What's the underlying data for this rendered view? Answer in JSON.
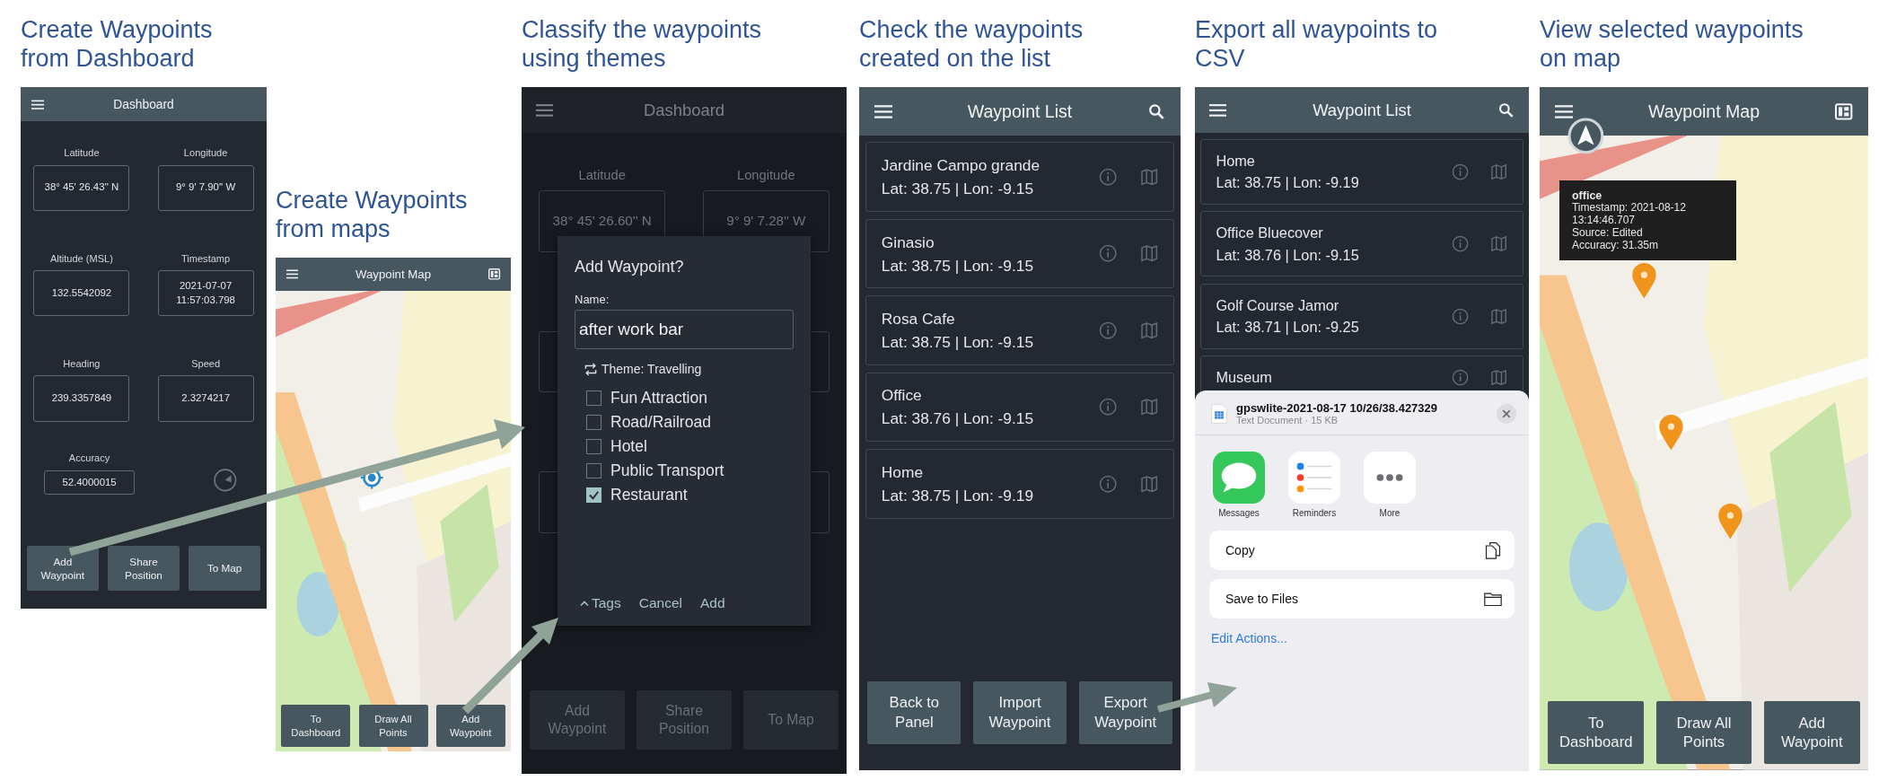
{
  "panels": [
    {
      "kind": "dashboard",
      "caption": "Create Waypoints from Dashboard",
      "screen": {
        "title": "Dashboard",
        "fields": [
          {
            "label": "Latitude",
            "value": "38° 45' 26.43'' N"
          },
          {
            "label": "Longitude",
            "value": "9° 9' 7.90'' W"
          },
          {
            "label": "Altitude (MSL)",
            "value": "132.5542092"
          },
          {
            "label": "Timestamp",
            "value": "2021-07-07 11:57:03.798"
          },
          {
            "label": "Heading",
            "value": "239.3357849"
          },
          {
            "label": "Speed",
            "value": "2.3274217"
          }
        ],
        "accuracy": {
          "label": "Accuracy",
          "value": "52.4000015"
        },
        "buttons": [
          "Add Waypoint",
          "Share Position",
          "To Map"
        ]
      }
    },
    {
      "kind": "map",
      "caption": "Create Waypoints from maps",
      "screen": {
        "title": "Waypoint Map",
        "buttons": [
          "To Dashboard",
          "Draw All Points",
          "Add Waypoint"
        ]
      }
    },
    {
      "kind": "dialog",
      "caption": "Classify the waypoints using themes",
      "screen": {
        "title": "Dashboard",
        "fields": [
          {
            "label": "Latitude",
            "value": "38° 45' 26.60'' N"
          },
          {
            "label": "Longitude",
            "value": "9° 9' 7.28'' W"
          }
        ],
        "buttons": [
          "Add Waypoint",
          "Share Position",
          "To Map"
        ],
        "dialog": {
          "title": "Add Waypoint?",
          "name_label": "Name:",
          "name_value": "after work bar",
          "theme": "Theme: Travelling",
          "options": [
            {
              "label": "Fun Attraction",
              "checked": false
            },
            {
              "label": "Road/Railroad",
              "checked": false
            },
            {
              "label": "Hotel",
              "checked": false
            },
            {
              "label": "Public Transport",
              "checked": false
            },
            {
              "label": "Restaurant",
              "checked": true
            }
          ],
          "actions": [
            "Tags",
            "Cancel",
            "Add"
          ]
        }
      }
    },
    {
      "kind": "list",
      "caption": "Check the waypoints created on the list",
      "screen": {
        "title": "Waypoint List",
        "items": [
          {
            "name": "Jardine Campo grande",
            "coords": "Lat: 38.75 | Lon: -9.15"
          },
          {
            "name": "Ginasio",
            "coords": "Lat: 38.75 | Lon: -9.15"
          },
          {
            "name": "Rosa Cafe",
            "coords": "Lat: 38.75 | Lon: -9.15"
          },
          {
            "name": "Office",
            "coords": "Lat: 38.76 | Lon: -9.15"
          },
          {
            "name": "Home",
            "coords": "Lat: 38.75 | Lon: -9.19"
          }
        ],
        "buttons": [
          "Back to Panel",
          "Import Waypoint",
          "Export Waypoint"
        ]
      }
    },
    {
      "kind": "share",
      "caption": "Export all waypoints to CSV",
      "screen": {
        "title": "Waypoint List",
        "items": [
          {
            "name": "Home",
            "coords": "Lat: 38.75 | Lon: -9.19"
          },
          {
            "name": "Office Bluecover",
            "coords": "Lat: 38.76 | Lon: -9.15"
          },
          {
            "name": "Golf Course Jamor",
            "coords": "Lat: 38.71 | Lon: -9.25"
          },
          {
            "name": "Museum"
          }
        ],
        "sheet": {
          "file": "gpswlite-2021-08-17 10/26/38.427329",
          "subtitle": "Text Document · 15 KB",
          "apps": [
            "Messages",
            "Reminders",
            "More"
          ],
          "actions": [
            "Copy",
            "Save to Files"
          ],
          "link": "Edit Actions..."
        }
      }
    },
    {
      "kind": "map_popup",
      "caption": "View selected waypoints on map",
      "screen": {
        "title": "Waypoint Map",
        "popup": {
          "title": "office",
          "lines": [
            "Timestamp: 2021-08-12 13:14:46.707",
            "Source: Edited",
            "Accuracy: 31.35m"
          ]
        },
        "buttons": [
          "To Dashboard",
          "Draw All Points",
          "Add Waypoint"
        ]
      }
    }
  ]
}
